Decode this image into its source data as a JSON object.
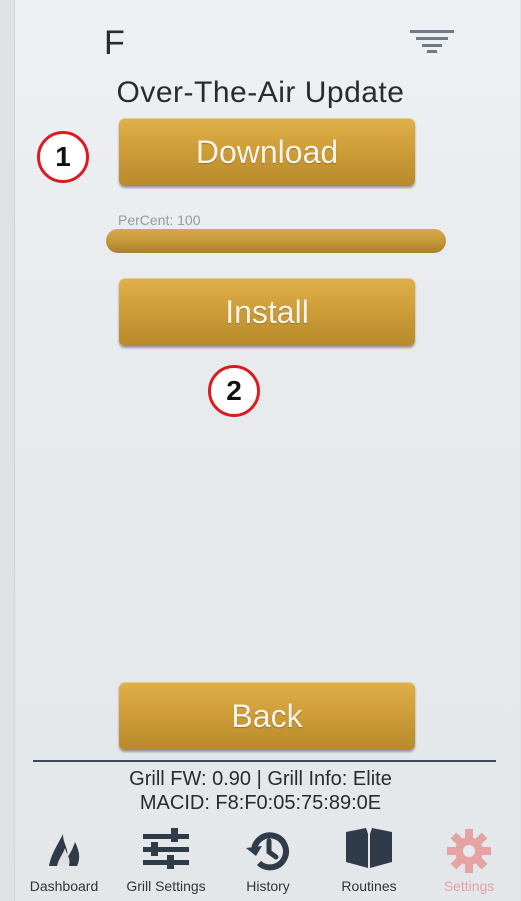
{
  "header": {
    "unit": "F",
    "title": "Over-The-Air Update"
  },
  "actions": {
    "download_label": "Download",
    "install_label": "Install",
    "back_label": "Back"
  },
  "progress": {
    "label": "PerCent: 100",
    "percent": 100
  },
  "markers": {
    "one": "1",
    "two": "2"
  },
  "device_info": {
    "firmware": "Grill FW: 0.90 | Grill Info: Elite",
    "mac": "MACID: F8:F0:05:75:89:0E"
  },
  "nav": {
    "items": [
      {
        "label": "Dashboard",
        "icon": "flame-icon"
      },
      {
        "label": "Grill Settings",
        "icon": "sliders-icon"
      },
      {
        "label": "History",
        "icon": "history-icon"
      },
      {
        "label": "Routines",
        "icon": "book-icon"
      },
      {
        "label": "Settings",
        "icon": "gear-icon"
      }
    ]
  },
  "colors": {
    "button_gold": "#cf9e39",
    "marker_red": "#e0191e",
    "settings_active": "#e5a3a3"
  }
}
